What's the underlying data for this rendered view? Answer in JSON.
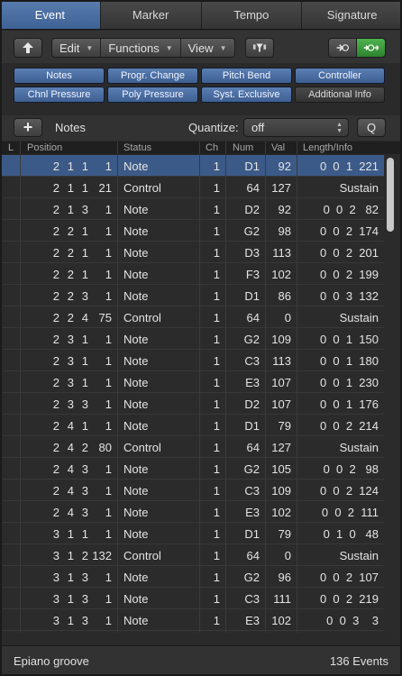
{
  "tabs": [
    "Event",
    "Marker",
    "Tempo",
    "Signature"
  ],
  "toolbar": {
    "menus": [
      "Edit",
      "Functions",
      "View"
    ]
  },
  "filters": {
    "row1": [
      "Notes",
      "Progr. Change",
      "Pitch Bend",
      "Controller"
    ],
    "row2": [
      "Chnl Pressure",
      "Poly Pressure",
      "Syst. Exclusive",
      "Additional Info"
    ]
  },
  "notes_bar": {
    "title": "Notes",
    "quantize_label": "Quantize:",
    "quantize_value": "off",
    "q_button": "Q"
  },
  "columns": {
    "l": "L",
    "position": "Position",
    "status": "Status",
    "ch": "Ch",
    "num": "Num",
    "val": "Val",
    "length": "Length/Info"
  },
  "rows": [
    {
      "p1": "2",
      "p2": "1",
      "p3": "1",
      "p4": "1",
      "status": "Note",
      "ch": "1",
      "num": "D1",
      "val": "92",
      "len": "0  0  1  221",
      "selected": true
    },
    {
      "p1": "2",
      "p2": "1",
      "p3": "1",
      "p4": "21",
      "status": "Control",
      "ch": "1",
      "num": "64",
      "val": "127",
      "len": "Sustain"
    },
    {
      "p1": "2",
      "p2": "1",
      "p3": "3",
      "p4": "1",
      "status": "Note",
      "ch": "1",
      "num": "D2",
      "val": "92",
      "len": "0  0  2   82"
    },
    {
      "p1": "2",
      "p2": "2",
      "p3": "1",
      "p4": "1",
      "status": "Note",
      "ch": "1",
      "num": "G2",
      "val": "98",
      "len": "0  0  2  174"
    },
    {
      "p1": "2",
      "p2": "2",
      "p3": "1",
      "p4": "1",
      "status": "Note",
      "ch": "1",
      "num": "D3",
      "val": "113",
      "len": "0  0  2  201"
    },
    {
      "p1": "2",
      "p2": "2",
      "p3": "1",
      "p4": "1",
      "status": "Note",
      "ch": "1",
      "num": "F3",
      "val": "102",
      "len": "0  0  2  199"
    },
    {
      "p1": "2",
      "p2": "2",
      "p3": "3",
      "p4": "1",
      "status": "Note",
      "ch": "1",
      "num": "D1",
      "val": "86",
      "len": "0  0  3  132"
    },
    {
      "p1": "2",
      "p2": "2",
      "p3": "4",
      "p4": "75",
      "status": "Control",
      "ch": "1",
      "num": "64",
      "val": "0",
      "len": "Sustain"
    },
    {
      "p1": "2",
      "p2": "3",
      "p3": "1",
      "p4": "1",
      "status": "Note",
      "ch": "1",
      "num": "G2",
      "val": "109",
      "len": "0  0  1  150"
    },
    {
      "p1": "2",
      "p2": "3",
      "p3": "1",
      "p4": "1",
      "status": "Note",
      "ch": "1",
      "num": "C3",
      "val": "113",
      "len": "0  0  1  180"
    },
    {
      "p1": "2",
      "p2": "3",
      "p3": "1",
      "p4": "1",
      "status": "Note",
      "ch": "1",
      "num": "E3",
      "val": "107",
      "len": "0  0  1  230"
    },
    {
      "p1": "2",
      "p2": "3",
      "p3": "3",
      "p4": "1",
      "status": "Note",
      "ch": "1",
      "num": "D2",
      "val": "107",
      "len": "0  0  1  176"
    },
    {
      "p1": "2",
      "p2": "4",
      "p3": "1",
      "p4": "1",
      "status": "Note",
      "ch": "1",
      "num": "D1",
      "val": "79",
      "len": "0  0  2  214"
    },
    {
      "p1": "2",
      "p2": "4",
      "p3": "2",
      "p4": "80",
      "status": "Control",
      "ch": "1",
      "num": "64",
      "val": "127",
      "len": "Sustain"
    },
    {
      "p1": "2",
      "p2": "4",
      "p3": "3",
      "p4": "1",
      "status": "Note",
      "ch": "1",
      "num": "G2",
      "val": "105",
      "len": "0  0  2   98"
    },
    {
      "p1": "2",
      "p2": "4",
      "p3": "3",
      "p4": "1",
      "status": "Note",
      "ch": "1",
      "num": "C3",
      "val": "109",
      "len": "0  0  2  124"
    },
    {
      "p1": "2",
      "p2": "4",
      "p3": "3",
      "p4": "1",
      "status": "Note",
      "ch": "1",
      "num": "E3",
      "val": "102",
      "len": "0  0  2  111"
    },
    {
      "p1": "3",
      "p2": "1",
      "p3": "1",
      "p4": "1",
      "status": "Note",
      "ch": "1",
      "num": "D1",
      "val": "79",
      "len": "0  1  0   48"
    },
    {
      "p1": "3",
      "p2": "1",
      "p3": "2",
      "p4": "132",
      "status": "Control",
      "ch": "1",
      "num": "64",
      "val": "0",
      "len": "Sustain"
    },
    {
      "p1": "3",
      "p2": "1",
      "p3": "3",
      "p4": "1",
      "status": "Note",
      "ch": "1",
      "num": "G2",
      "val": "96",
      "len": "0  0  2  107"
    },
    {
      "p1": "3",
      "p2": "1",
      "p3": "3",
      "p4": "1",
      "status": "Note",
      "ch": "1",
      "num": "C3",
      "val": "111",
      "len": "0  0  2  219"
    },
    {
      "p1": "3",
      "p2": "1",
      "p3": "3",
      "p4": "1",
      "status": "Note",
      "ch": "1",
      "num": "E3",
      "val": "102",
      "len": "0  0  3    3"
    }
  ],
  "status_bar": {
    "region": "Epiano groove",
    "count": "136 Events"
  },
  "colors": {
    "accent": "#4a6fa5",
    "selected_row": "#3c5a88",
    "green_toggle": "#3e9a3e"
  },
  "icons": [
    "up-arrow-icon",
    "midi-filter-icon",
    "midi-in-icon",
    "midi-out-icon",
    "plus-icon"
  ]
}
